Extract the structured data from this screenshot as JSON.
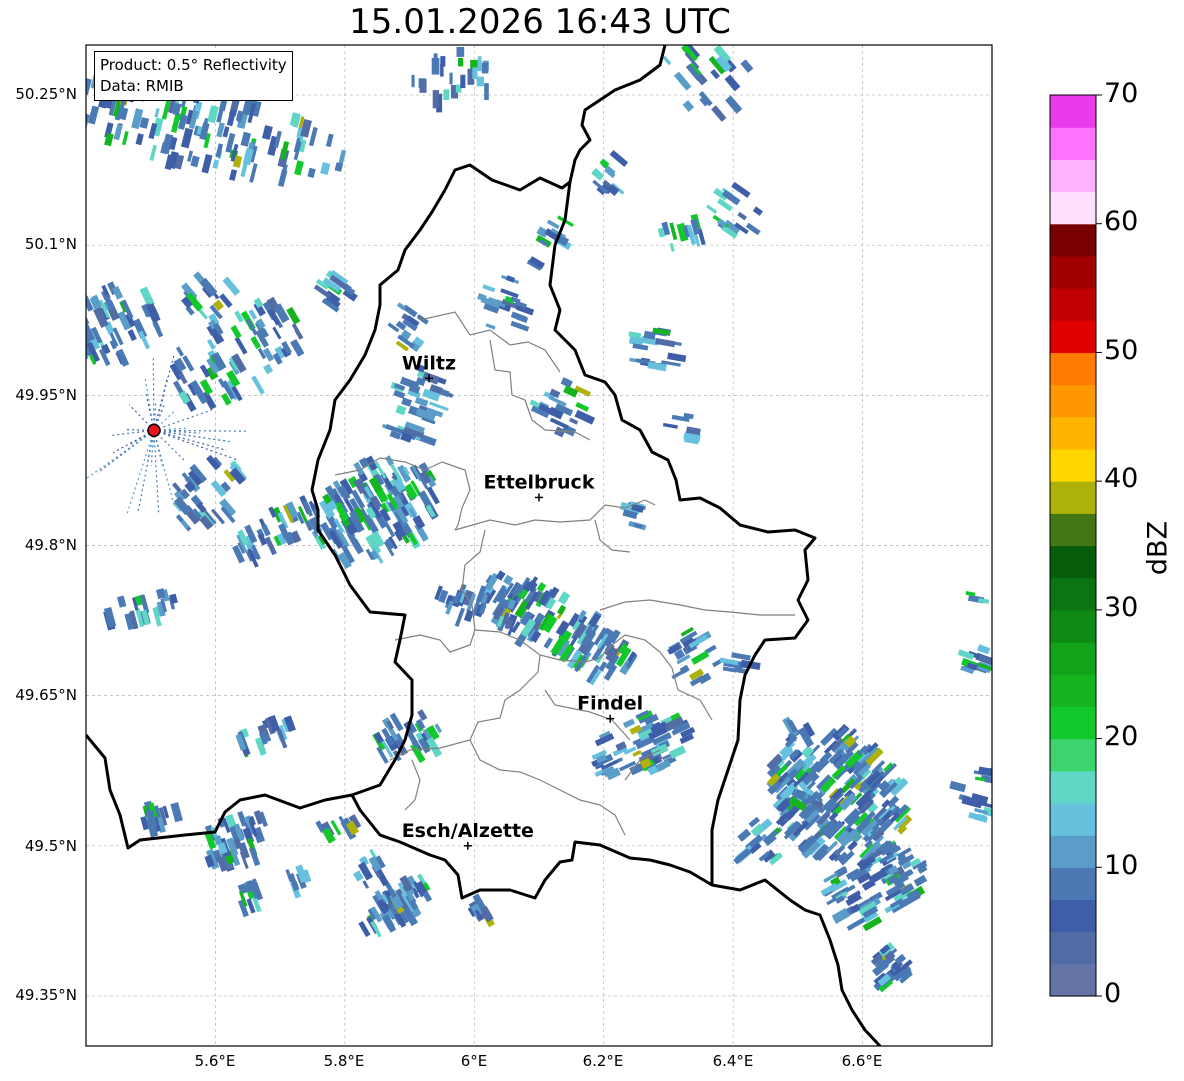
{
  "title": "15.01.2026 16:43 UTC",
  "info": {
    "product": "Product: 0.5° Reflectivity",
    "source": "Data: RMIB"
  },
  "axes": {
    "lon_ticks": [
      "5.6°E",
      "5.8°E",
      "6°E",
      "6.2°E",
      "6.4°E",
      "6.6°E"
    ],
    "lat_ticks": [
      "50.25°N",
      "50.1°N",
      "49.95°N",
      "49.8°N",
      "49.65°N",
      "49.5°N",
      "49.35°N"
    ],
    "lon_range": [
      5.4,
      6.8
    ],
    "lat_range": [
      49.3,
      50.3
    ]
  },
  "cities": [
    {
      "name": "Wiltz",
      "lon": 5.93,
      "lat": 49.967
    },
    {
      "name": "Ettelbruck",
      "lon": 6.1,
      "lat": 49.848
    },
    {
      "name": "Findel",
      "lon": 6.21,
      "lat": 49.627
    },
    {
      "name": "Esch/Alzette",
      "lon": 5.99,
      "lat": 49.5
    }
  ],
  "radar_site": {
    "lon": 5.505,
    "lat": 49.915,
    "color": "#e8141c"
  },
  "colorbar": {
    "label": "dBZ",
    "min": 0,
    "max": 70,
    "ticks": [
      "0",
      "10",
      "20",
      "30",
      "40",
      "50",
      "60",
      "70"
    ],
    "colors": [
      "#6474a6",
      "#526ca6",
      "#3f5ea8",
      "#4a79b4",
      "#5a9dc8",
      "#66c1de",
      "#5fd6c6",
      "#3dd36e",
      "#12c82a",
      "#14b41f",
      "#12a31a",
      "#0f8b15",
      "#0c7412",
      "#085d0c",
      "#427713",
      "#aeb108",
      "#ffd600",
      "#ffb500",
      "#ff9800",
      "#ff7c00",
      "#e00000",
      "#c00000",
      "#a00000",
      "#780000",
      "#ffe0ff",
      "#ffb2ff",
      "#ff72ff",
      "#e93be9"
    ]
  }
}
